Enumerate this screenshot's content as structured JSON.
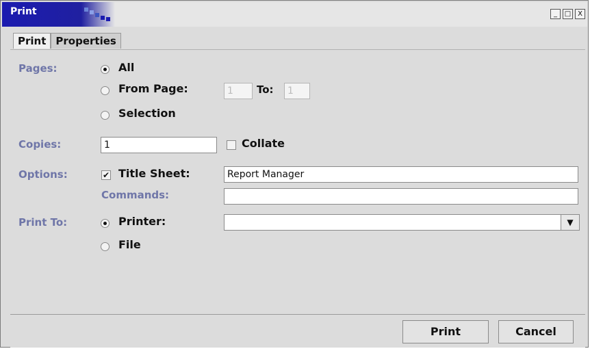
{
  "window": {
    "title": "Print",
    "minimize": "_",
    "maximize": "□",
    "close": "X"
  },
  "tabs": [
    {
      "label": "Print",
      "active": true
    },
    {
      "label": "Properties",
      "active": false
    }
  ],
  "pages": {
    "label": "Pages:",
    "all": "All",
    "from_page": "From Page:",
    "from_value": "1",
    "to_label": "To:",
    "to_value": "1",
    "selection": "Selection",
    "selected": "All"
  },
  "copies": {
    "label": "Copies:",
    "value": "1",
    "collate": "Collate",
    "collate_checked": false
  },
  "options": {
    "label": "Options:",
    "title_sheet": "Title Sheet:",
    "title_sheet_checked": true,
    "title_value": "Report Manager",
    "commands_label": "Commands:",
    "commands_value": ""
  },
  "print_to": {
    "label": "Print To:",
    "printer": "Printer:",
    "printer_value": "",
    "file": "File",
    "selected": "Printer"
  },
  "buttons": {
    "print": "Print",
    "cancel": "Cancel"
  },
  "colors": {
    "title_accent": "#1b1bb0",
    "label": "#6f76a8"
  }
}
